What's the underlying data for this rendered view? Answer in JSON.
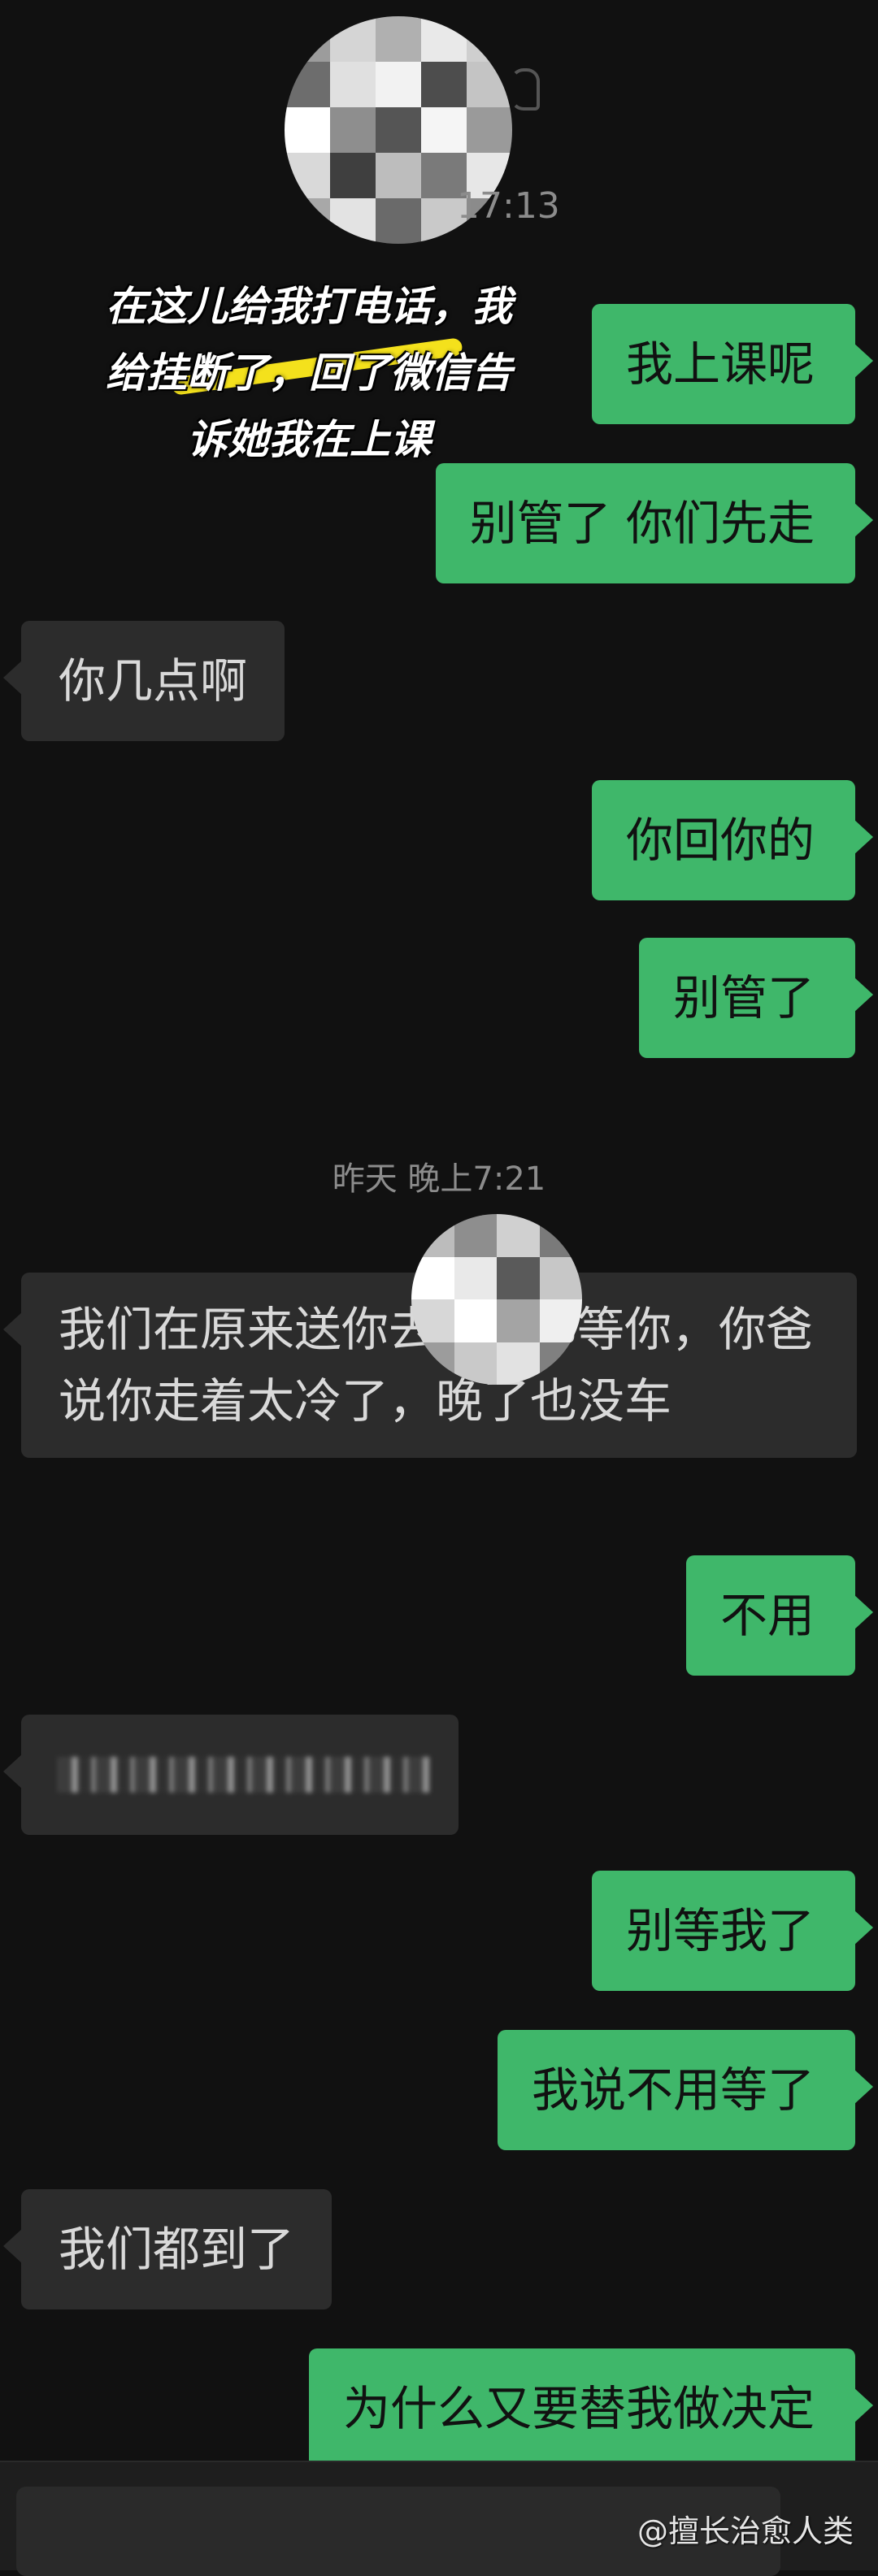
{
  "conversation": {
    "timestamps": {
      "top": "17:13",
      "middle": "昨天 晚上7:21"
    },
    "caption": {
      "line1": "在这儿给我打电话，我",
      "line2": "给挂断了，回了微信告",
      "line3": "诉她我在上课"
    },
    "messages": [
      {
        "side": "me",
        "text": "我上课呢"
      },
      {
        "side": "me",
        "text": "别管了 你们先走"
      },
      {
        "side": "them",
        "text": "你几点啊"
      },
      {
        "side": "me",
        "text": "你回你的"
      },
      {
        "side": "me",
        "text": "别管了"
      },
      {
        "side": "them",
        "text": "我们在原来送你去上课那等你，你爸说你走着太冷了，晚了也没车"
      },
      {
        "side": "me",
        "text": "不用"
      },
      {
        "side": "them",
        "text": ""
      },
      {
        "side": "me",
        "text": "别等我了"
      },
      {
        "side": "me",
        "text": "我说不用等了"
      },
      {
        "side": "them",
        "text": "我们都到了"
      },
      {
        "side": "me",
        "text": "为什么又要替我做决定"
      }
    ]
  },
  "watermark": "@擅长治愈人类",
  "colors": {
    "background": "#111111",
    "my_bubble": "#3fb76a",
    "their_bubble": "#2c2c2c"
  }
}
